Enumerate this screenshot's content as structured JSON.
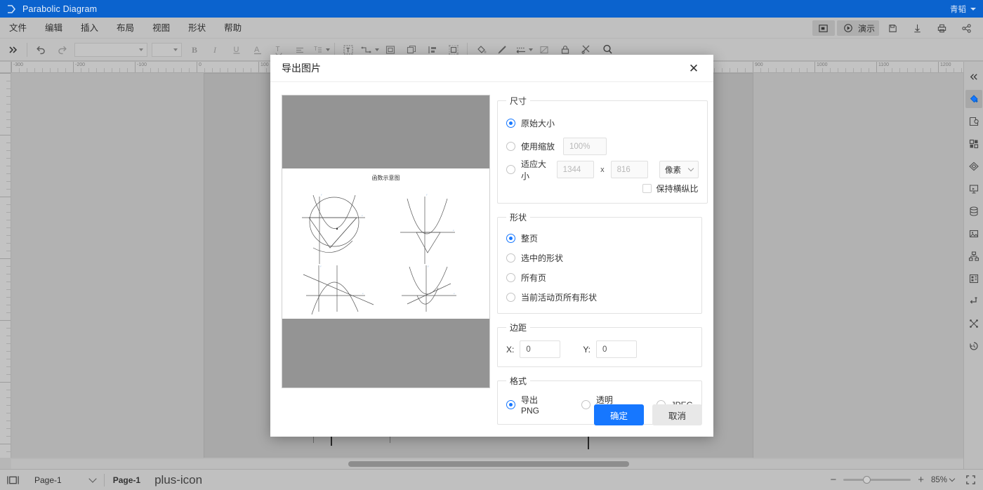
{
  "titlebar": {
    "app_title": "Parabolic Diagram",
    "user": "青韬",
    "logo": "drawio-logo-icon"
  },
  "menubar": {
    "items": [
      "文件",
      "编辑",
      "插入",
      "布局",
      "视图",
      "形状",
      "帮助"
    ],
    "right_buttons": [
      {
        "name": "present-mode-icon",
        "label": ""
      },
      {
        "name": "slideshow-button",
        "label": "演示"
      },
      {
        "name": "save-icon",
        "label": ""
      },
      {
        "name": "download-icon",
        "label": ""
      },
      {
        "name": "print-icon",
        "label": ""
      },
      {
        "name": "share-icon",
        "label": ""
      }
    ]
  },
  "toolbar": {
    "icons": [
      "expand-chevrons-icon",
      "undo-icon",
      "redo-icon",
      "bold-icon",
      "italic-icon",
      "underline-icon",
      "font-color-icon",
      "text-style-icon",
      "align-icon",
      "text-format-icon",
      "text-tool-icon",
      "connection-icon",
      "fill-panel-icon",
      "duplicate-icon",
      "align-left-icon",
      "group-icon",
      "fill-bucket-icon",
      "line-brush-icon",
      "line-style-icon",
      "no-fill-icon",
      "lock-icon",
      "tools-icon",
      "search-icon"
    ],
    "font_combo_value": "",
    "size_combo_value": ""
  },
  "rail": {
    "icons": [
      "collapse-panel-icon",
      "format-fill-icon",
      "edit-shape-icon",
      "shapes-grid-icon",
      "layers-icon",
      "presentation-icon",
      "database-icon",
      "image-icon",
      "org-chart-icon",
      "template-icon",
      "connector-icon",
      "scatter-icon",
      "history-icon"
    ]
  },
  "statusbar": {
    "page_view_icon": "page-view-icon",
    "page_selector": "Page-1",
    "current_tab": "Page-1",
    "add_page_icon": "plus-icon",
    "zoom_minus": "−",
    "zoom_plus": "+",
    "zoom_level": "85%",
    "fullscreen_icon": "fullscreen-icon"
  },
  "dialog": {
    "title": "导出图片",
    "close_icon": "close-icon",
    "preview": {
      "diagram_title": "函数示意图"
    },
    "size": {
      "legend": "尺寸",
      "options": [
        {
          "label": "原始大小",
          "selected": true
        },
        {
          "label": "使用缩放",
          "selected": false
        },
        {
          "label": "适应大小",
          "selected": false
        }
      ],
      "zoom_value": "100%",
      "width_value": "1344",
      "height_value": "816",
      "x_separator": "x",
      "unit_value": "像素",
      "aspect_label": "保持横纵比",
      "aspect_checked": false
    },
    "shape": {
      "legend": "形状",
      "options": [
        {
          "label": "整页",
          "selected": true
        },
        {
          "label": "选中的形状",
          "selected": false
        },
        {
          "label": "所有页",
          "selected": false
        },
        {
          "label": "当前活动页所有形状",
          "selected": false
        }
      ]
    },
    "margin": {
      "legend": "边距",
      "x_label": "X:",
      "x_value": "0",
      "y_label": "Y:",
      "y_value": "0"
    },
    "format": {
      "legend": "格式",
      "options": [
        {
          "label": "导出PNG",
          "selected": true
        },
        {
          "label": "透明PNG",
          "selected": false
        },
        {
          "label": "JPEG",
          "selected": false
        }
      ]
    },
    "confirm_label": "确定",
    "cancel_label": "取消"
  },
  "colors": {
    "titlebar": "#0b63ce",
    "accent": "#1677ff",
    "chrome": "#c0c0c0",
    "canvas": "#b2b2b2"
  }
}
